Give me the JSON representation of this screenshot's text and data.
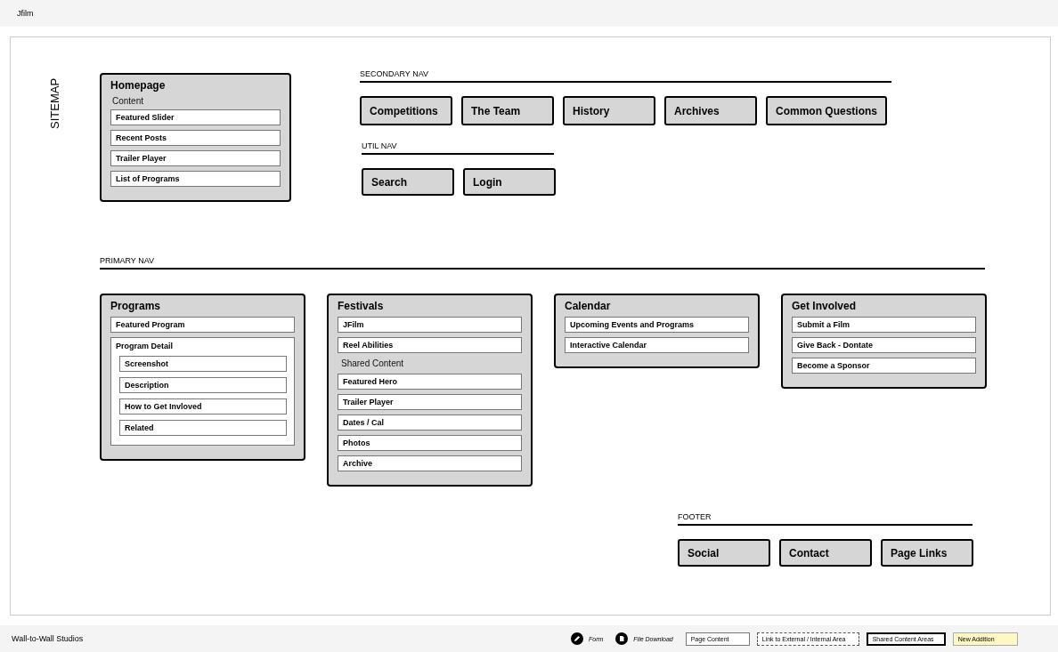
{
  "header": {
    "title": "Jfilm"
  },
  "sitemap_label": "SITEMAP",
  "homepage": {
    "title": "Homepage",
    "items": [
      {
        "kind": "heading",
        "label": "Content"
      },
      {
        "kind": "page",
        "label": "Featured Slider"
      },
      {
        "kind": "page",
        "label": "Recent Posts"
      },
      {
        "kind": "page",
        "label": "Trailer Player"
      },
      {
        "kind": "page",
        "label": "List of Programs"
      }
    ]
  },
  "secondary_nav": {
    "label": "SECONDARY NAV",
    "buttons": [
      "Competitions",
      "The Team",
      "History",
      "Archives",
      "Common Questions"
    ]
  },
  "util_nav": {
    "label": "UTIL NAV",
    "buttons": [
      "Search",
      "Login"
    ]
  },
  "primary_nav": {
    "label": "PRIMARY NAV",
    "sections": [
      {
        "title": "Programs",
        "items": [
          {
            "kind": "page",
            "label": "Featured Program"
          },
          {
            "kind": "group",
            "label": "Program Detail",
            "children": [
              {
                "kind": "page",
                "label": "Screenshot"
              },
              {
                "kind": "page",
                "label": "Description"
              },
              {
                "kind": "page",
                "label": "How to Get Invloved"
              },
              {
                "kind": "page",
                "label": "Related"
              }
            ]
          }
        ]
      },
      {
        "title": "Festivals",
        "items": [
          {
            "kind": "page",
            "label": "JFilm"
          },
          {
            "kind": "page",
            "label": "Reel Abilities"
          },
          {
            "kind": "heading",
            "label": "Shared Content"
          },
          {
            "kind": "page",
            "label": "Featured Hero"
          },
          {
            "kind": "page",
            "label": "Trailer Player"
          },
          {
            "kind": "page",
            "label": "Dates / Cal"
          },
          {
            "kind": "page",
            "label": "Photos"
          },
          {
            "kind": "page",
            "label": "Archive"
          }
        ]
      },
      {
        "title": "Calendar",
        "items": [
          {
            "kind": "page",
            "label": "Upcoming Events and Programs"
          },
          {
            "kind": "page",
            "label": "Interactive Calendar"
          }
        ]
      },
      {
        "title": "Get Involved",
        "items": [
          {
            "kind": "page",
            "label": "Submit a Film"
          },
          {
            "kind": "page",
            "label": "Give Back - Dontate"
          },
          {
            "kind": "page",
            "label": "Become a Sponsor"
          }
        ]
      }
    ]
  },
  "footer_nav": {
    "label": "FOOTER",
    "buttons": [
      "Social",
      "Contact",
      "Page Links"
    ]
  },
  "footer": {
    "credit": "Wall-to-Wall Studios",
    "legend": [
      {
        "kind": "form",
        "label": "Form"
      },
      {
        "kind": "download",
        "label": "File Download"
      },
      {
        "kind": "page",
        "label": "Page Content"
      },
      {
        "kind": "link",
        "label": "Link to External / Internal Area"
      },
      {
        "kind": "shared",
        "label": "Shared Content Areas"
      },
      {
        "kind": "new",
        "label": "New Addition"
      }
    ]
  }
}
